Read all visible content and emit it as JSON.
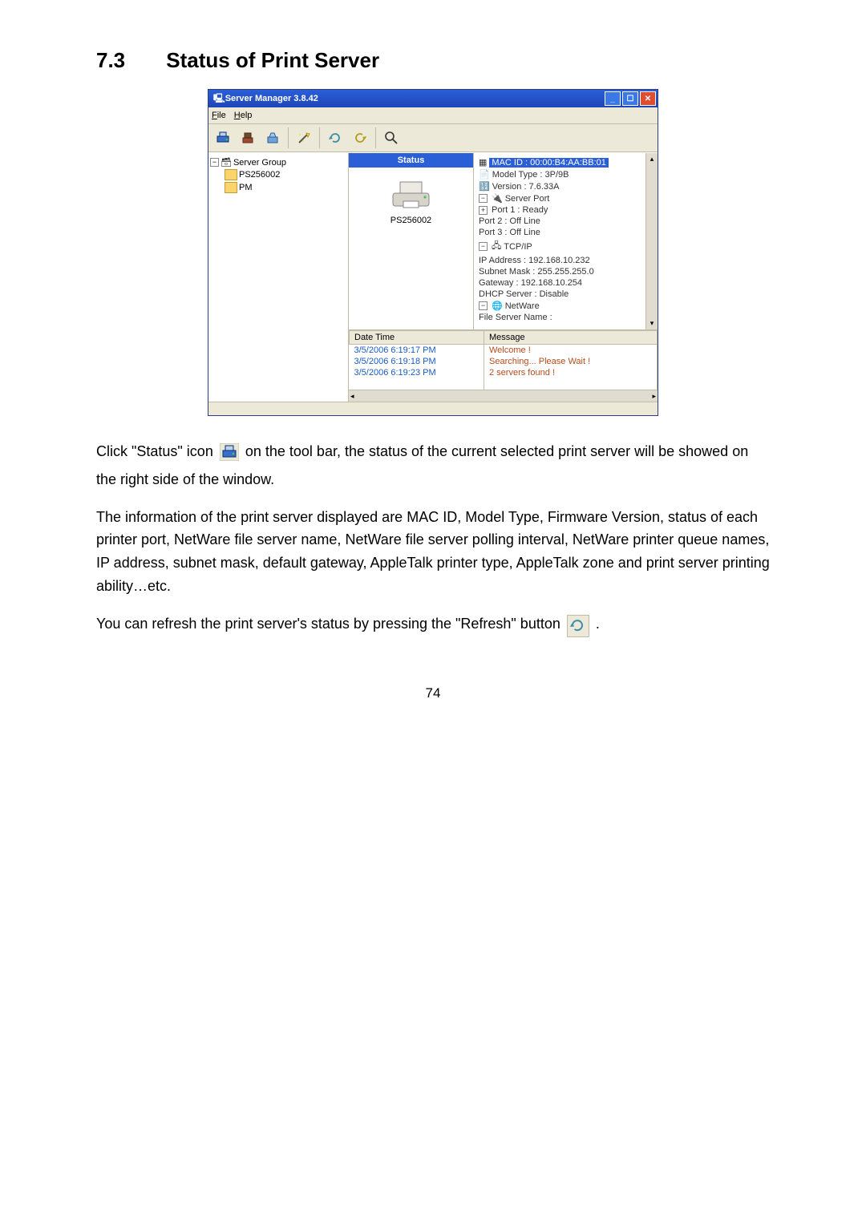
{
  "heading": {
    "num": "7.3",
    "title": "Status of Print Server"
  },
  "app": {
    "title": "Server Manager 3.8.42",
    "menu": {
      "file": "File",
      "help": "Help"
    },
    "tree": {
      "root": "Server Group",
      "item1": "PS256002",
      "item2": "PM"
    },
    "status_label": "Status",
    "printer_name": "PS256002",
    "details": {
      "mac": "MAC ID : 00:00:B4:AA:BB:01",
      "model": "Model Type : 3P/9B",
      "version": "Version : 7.6.33A",
      "serverport": "Server Port",
      "port1": "Port 1 : Ready",
      "port2": "Port 2 : Off Line",
      "port3": "Port 3 : Off Line",
      "tcpip": "TCP/IP",
      "ip": "IP Address : 192.168.10.232",
      "subnet": "Subnet Mask : 255.255.255.0",
      "gateway": "Gateway : 192.168.10.254",
      "dhcp": "DHCP Server : Disable",
      "netware": "NetWare",
      "fileserver": "File Server Name :"
    },
    "table": {
      "h1": "Date Time",
      "h2": "Message",
      "r1t": "3/5/2006 6:19:17 PM",
      "r1m": "Welcome !",
      "r2t": "3/5/2006 6:19:18 PM",
      "r2m": "Searching... Please Wait !",
      "r3t": "3/5/2006 6:19:23 PM",
      "r3m": "2 servers found !"
    }
  },
  "para1a": "Click \"Status\" icon",
  "para1b": " on the tool bar, the status of the current selected print server will be showed on the right side of the window.",
  "para2": "The information of the print server displayed are MAC ID, Model Type, Firmware Version, status of each printer port, NetWare file server name, NetWare file server polling interval, NetWare printer queue names, IP address, subnet mask, default gateway, AppleTalk printer type, AppleTalk zone and print server printing ability…etc.",
  "para3a": "You can refresh the print server's status by pressing the \"Refresh\" button ",
  "para3b": ".",
  "pagenum": "74"
}
